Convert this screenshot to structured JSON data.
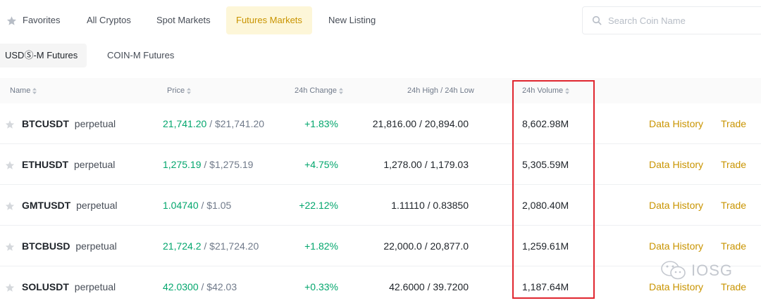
{
  "top_tabs": [
    {
      "label": "Favorites",
      "icon": "star-icon"
    },
    {
      "label": "All Cryptos"
    },
    {
      "label": "Spot Markets"
    },
    {
      "label": "Futures Markets",
      "active": true
    },
    {
      "label": "New Listing"
    }
  ],
  "search": {
    "placeholder": "Search Coin Name",
    "icon": "search-icon"
  },
  "sub_tabs": [
    {
      "label": "USDⓈ-M Futures",
      "active": true
    },
    {
      "label": "COIN-M Futures"
    }
  ],
  "columns": {
    "name": "Name",
    "price": "Price",
    "change": "24h Change",
    "high_low": "24h High / 24h Low",
    "volume": "24h Volume"
  },
  "rows": [
    {
      "symbol": "BTCUSDT",
      "type": "perpetual",
      "price": "21,741.20",
      "price_usd": "/ $21,741.20",
      "change": "+1.83%",
      "high_low": "21,816.00 / 20,894.00",
      "volume": "8,602.98M",
      "data_history": "Data History",
      "trade": "Trade"
    },
    {
      "symbol": "ETHUSDT",
      "type": "perpetual",
      "price": "1,275.19",
      "price_usd": "/ $1,275.19",
      "change": "+4.75%",
      "high_low": "1,278.00 / 1,179.03",
      "volume": "5,305.59M",
      "data_history": "Data History",
      "trade": "Trade"
    },
    {
      "symbol": "GMTUSDT",
      "type": "perpetual",
      "price": "1.04740",
      "price_usd": "/ $1.05",
      "change": "+22.12%",
      "high_low": "1.11110 / 0.83850",
      "volume": "2,080.40M",
      "data_history": "Data History",
      "trade": "Trade"
    },
    {
      "symbol": "BTCBUSD",
      "type": "perpetual",
      "price": "21,724.2",
      "price_usd": "/ $21,724.20",
      "change": "+1.82%",
      "high_low": "22,000.0 / 20,877.0",
      "volume": "1,259.61M",
      "data_history": "Data History",
      "trade": "Trade"
    },
    {
      "symbol": "SOLUSDT",
      "type": "perpetual",
      "price": "42.0300",
      "price_usd": "/ $42.03",
      "change": "+0.33%",
      "high_low": "42.6000 / 39.7200",
      "volume": "1,187.64M",
      "data_history": "Data History",
      "trade": "Trade"
    }
  ],
  "watermark": {
    "text": "IOSG",
    "icon": "wechat-icon"
  },
  "colors": {
    "accent": "#c99400",
    "positive": "#03a66d",
    "highlight_box": "#e0262f",
    "active_tab_bg": "#fdf6d8"
  }
}
